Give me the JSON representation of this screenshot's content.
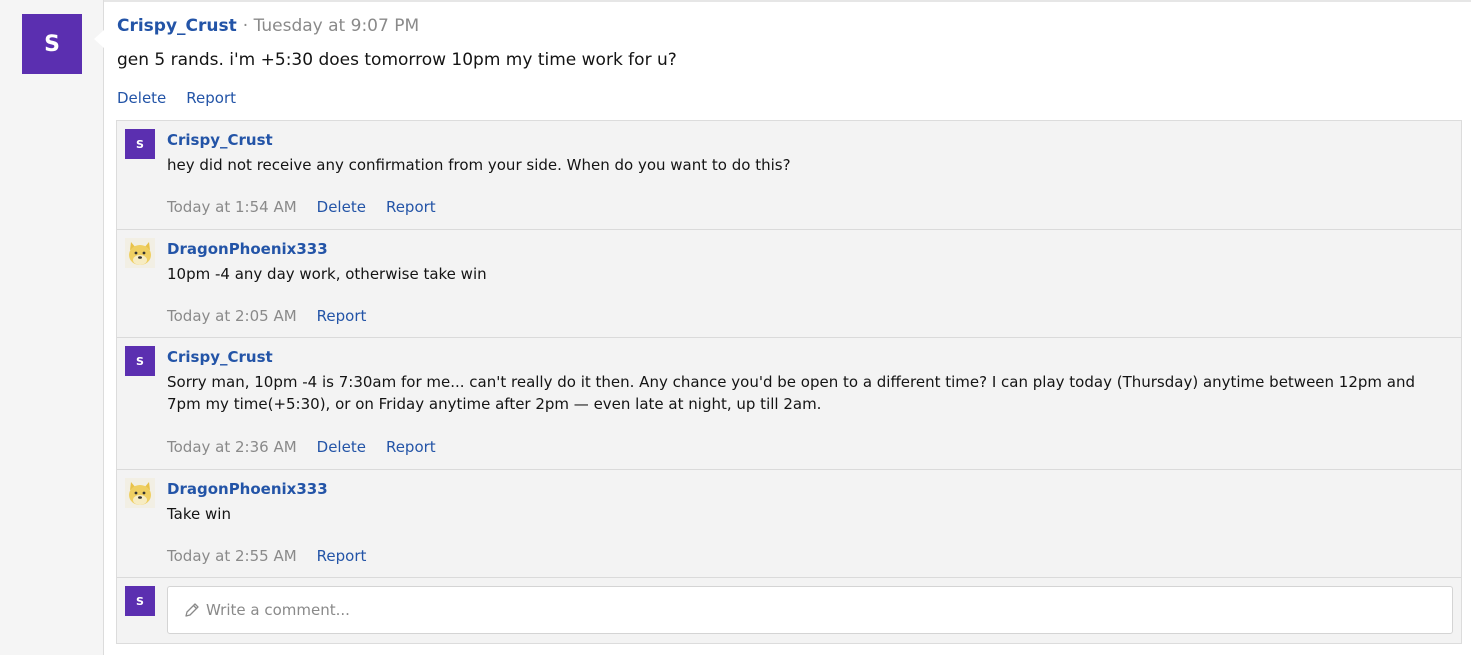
{
  "post": {
    "avatar_letter": "S",
    "author": "Crispy_Crust",
    "separator": "·",
    "time": "Tuesday at 9:07 PM",
    "body": "gen 5 rands. i'm +5:30 does tomorrow 10pm my time work for u?",
    "actions": {
      "delete": "Delete",
      "report": "Report"
    }
  },
  "comments": [
    {
      "avatar_letter": "S",
      "author": "Crispy_Crust",
      "text": "hey did not receive any confirmation from your side. When do you want to do this?",
      "time": "Today at 1:54 AM",
      "delete": "Delete",
      "report": "Report"
    },
    {
      "avatar_icon": "doge-avatar-icon",
      "author": "DragonPhoenix333",
      "text": "10pm -4 any day work, otherwise take win",
      "time": "Today at 2:05 AM",
      "report": "Report"
    },
    {
      "avatar_letter": "S",
      "author": "Crispy_Crust",
      "text": "Sorry man, 10pm -4 is 7:30am for me... can't really do it then. Any chance you'd be open to a different time? I can play today (Thursday) anytime between 12pm and 7pm my time(+5:30), or on Friday anytime after 2pm — even late at night, up till 2am.",
      "time": "Today at 2:36 AM",
      "delete": "Delete",
      "report": "Report"
    },
    {
      "avatar_icon": "doge-avatar-icon",
      "author": "DragonPhoenix333",
      "text": "Take win",
      "time": "Today at 2:55 AM",
      "report": "Report"
    }
  ],
  "comment_box": {
    "avatar_letter": "S",
    "placeholder": "Write a comment...",
    "icon": "pencil-icon"
  },
  "colors": {
    "accent": "#5b2fb0",
    "link": "#2354a7"
  }
}
